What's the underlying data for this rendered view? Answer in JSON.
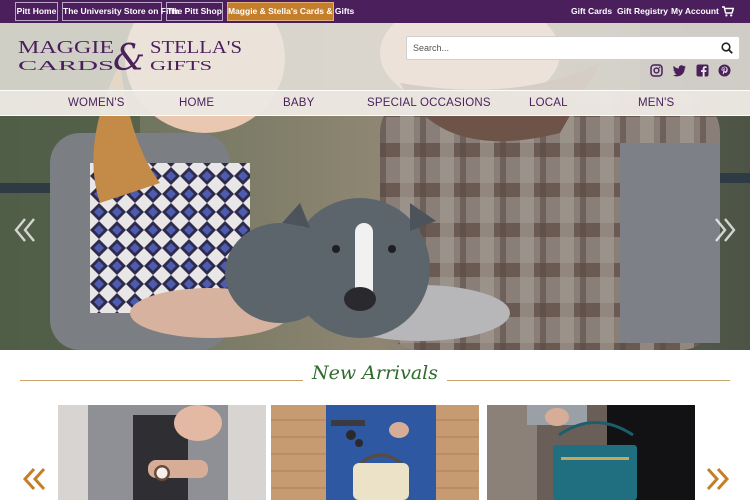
{
  "site_tabs": [
    {
      "label": "Pitt Home",
      "active": false
    },
    {
      "label": "The University Store on Fifth",
      "active": false
    },
    {
      "label": "The Pitt Shop",
      "active": false
    },
    {
      "label": "Maggie & Stella's Cards & Gifts",
      "active": true
    }
  ],
  "utility": {
    "gift_cards": "Gift Cards",
    "gift_registry": "Gift Registry",
    "my_account": "My Account"
  },
  "logo": {
    "line1_left": "MAGGIE",
    "line1_right": "STELLA'S",
    "line2_left": "CARDS",
    "line2_right": "GIFTS",
    "ampersand": "&"
  },
  "search": {
    "placeholder": "Search..."
  },
  "social_icons": [
    "instagram-icon",
    "twitter-icon",
    "facebook-icon",
    "pinterest-icon"
  ],
  "nav": [
    "WOMEN'S",
    "HOME",
    "BABY",
    "SPECIAL OCCASIONS",
    "LOCAL",
    "MEN'S"
  ],
  "section": {
    "title": "New Arrivals"
  },
  "colors": {
    "brand_purple": "#4a1f5c",
    "accent_orange": "#c57e2a",
    "title_green": "#2f6b2a",
    "rule_gold": "#c9a36a"
  }
}
